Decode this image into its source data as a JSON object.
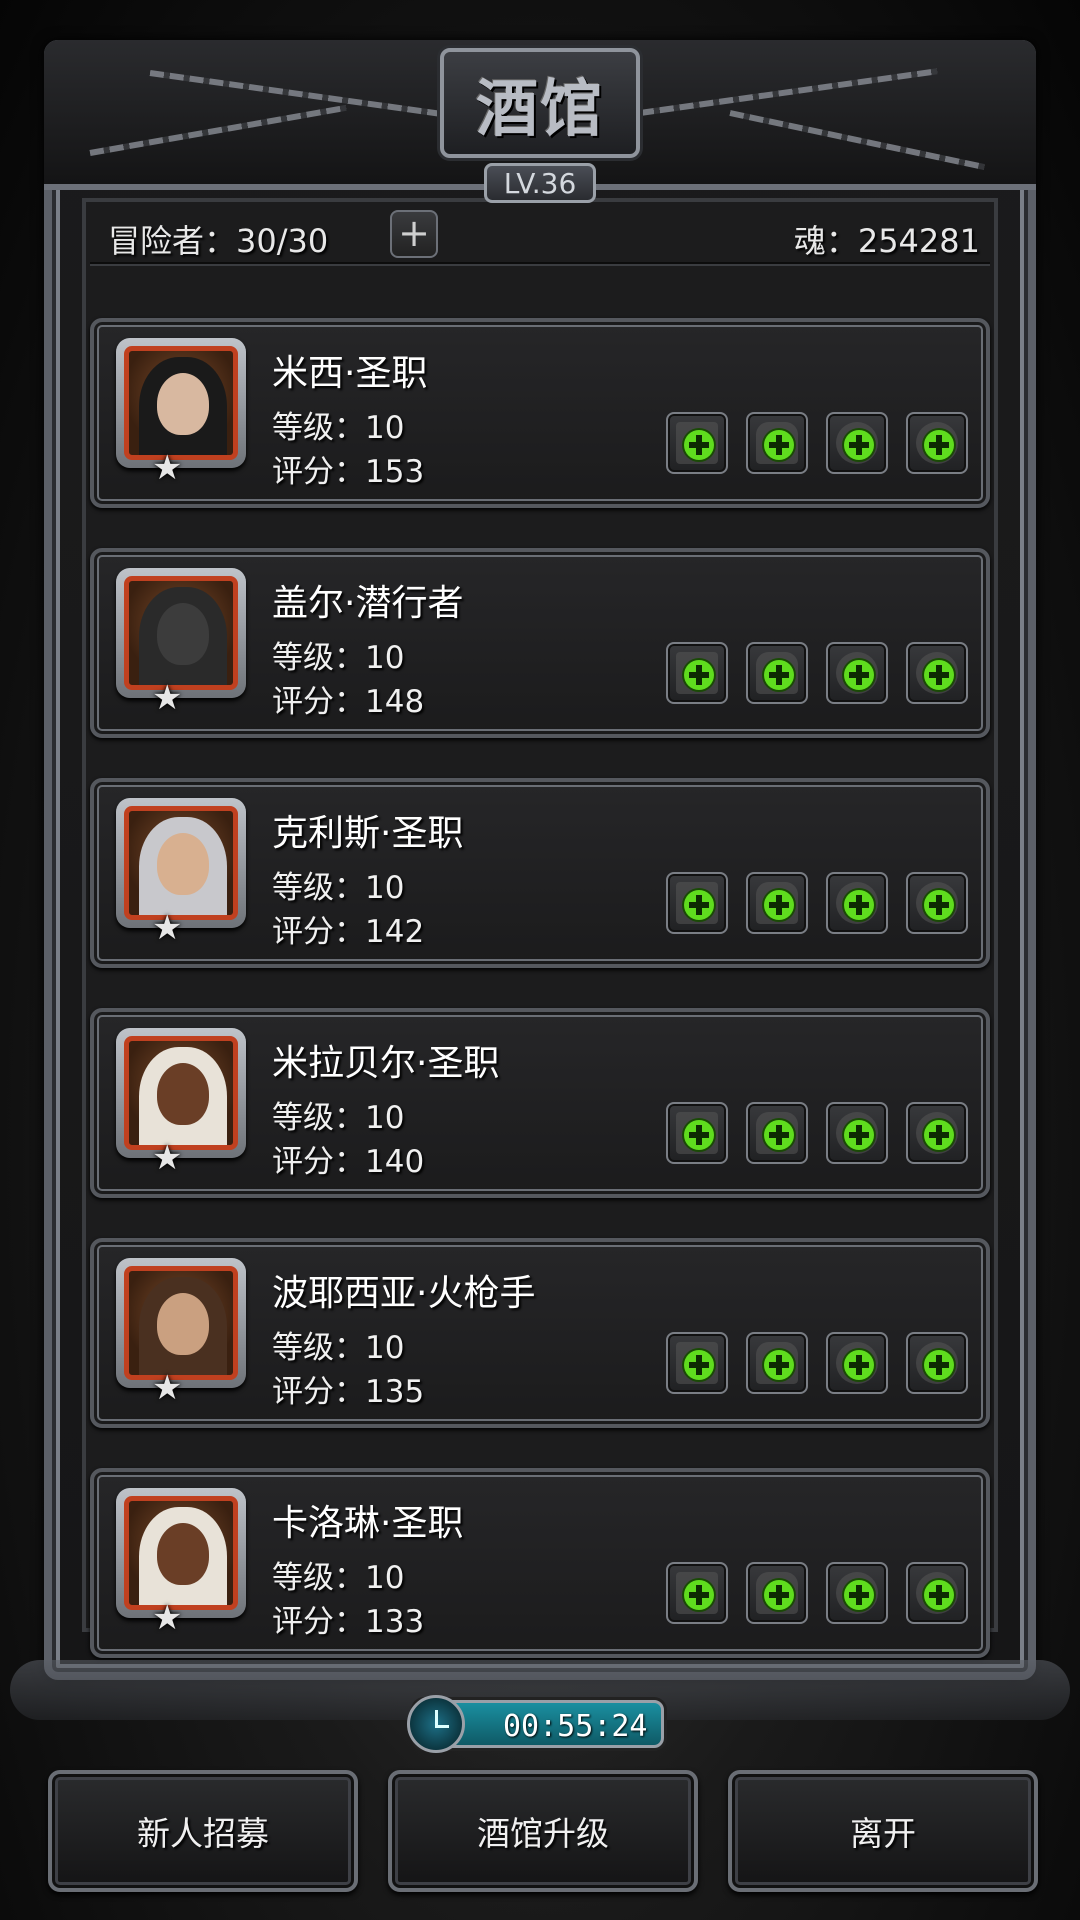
{
  "tavern": {
    "title": "酒馆",
    "level": "LV.36"
  },
  "stats": {
    "adventurers": "冒险者：30/30",
    "add_symbol": "+",
    "soul": "魂：254281"
  },
  "heroes": [
    {
      "name": "米西·圣职",
      "level": "等级：10",
      "score": "评分：153",
      "star": "★",
      "stars": 1
    },
    {
      "name": "盖尔·潜行者",
      "level": "等级：10",
      "score": "评分：148",
      "star": "★",
      "stars": 1
    },
    {
      "name": "克利斯·圣职",
      "level": "等级：10",
      "score": "评分：142",
      "star": "★",
      "stars": 1
    },
    {
      "name": "米拉贝尔·圣职",
      "level": "等级：10",
      "score": "评分：140",
      "star": "★",
      "stars": 1
    },
    {
      "name": "波耶西亚·火枪手",
      "level": "等级：10",
      "score": "评分：135",
      "star": "★",
      "stars": 1
    },
    {
      "name": "卡洛琳·圣职",
      "level": "等级：10",
      "score": "评分：133",
      "star": "★",
      "stars": 1
    }
  ],
  "equipment_slots": [
    "weapon-slot-icon",
    "armor-slot-icon",
    "accessory-slot-icon",
    "ring-slot-icon"
  ],
  "timer": "00:55:24",
  "buttons": {
    "recruit": "新人招募",
    "upgrade": "酒馆升级",
    "leave": "离开"
  },
  "colors": {
    "accent_green": "#5fdc1e",
    "portrait_border": "#c0401f",
    "timer_bg": "#1a8fa0"
  }
}
